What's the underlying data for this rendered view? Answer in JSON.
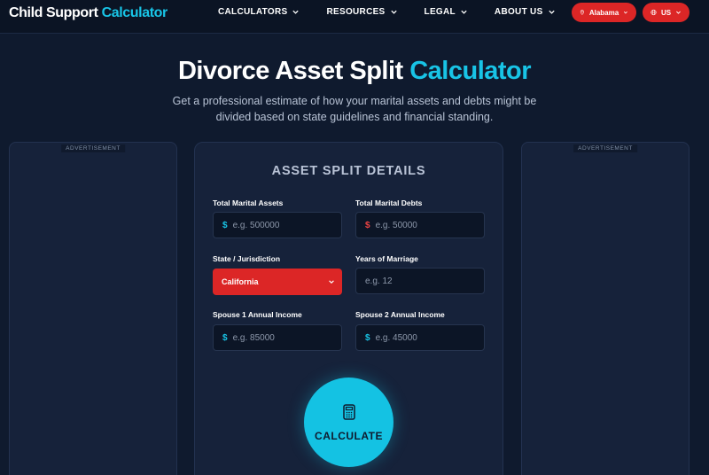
{
  "brand": {
    "name_main": "Child Support ",
    "name_accent": "Calculator"
  },
  "nav": {
    "items": [
      {
        "label": "CALCULATORS"
      },
      {
        "label": "RESOURCES"
      },
      {
        "label": "LEGAL"
      },
      {
        "label": "ABOUT US"
      }
    ],
    "state_selector": "Alabama",
    "country_selector": "US"
  },
  "hero": {
    "title_main": "Divorce Asset Split ",
    "title_accent": "Calculator",
    "subtitle": "Get a professional estimate of how your marital assets and debts might be divided based on state guidelines and financial standing."
  },
  "ads": {
    "label": "ADVERTISEMENT"
  },
  "form": {
    "title": "ASSET SPLIT DETAILS",
    "total_assets": {
      "label": "Total Marital Assets",
      "currency": "$",
      "placeholder": "e.g. 500000"
    },
    "total_debts": {
      "label": "Total Marital Debts",
      "currency": "$",
      "placeholder": "e.g. 50000"
    },
    "state": {
      "label": "State / Jurisdiction",
      "value": "California"
    },
    "years": {
      "label": "Years of Marriage",
      "placeholder": "e.g. 12"
    },
    "spouse1_income": {
      "label": "Spouse 1 Annual Income",
      "currency": "$",
      "placeholder": "e.g. 85000"
    },
    "spouse2_income": {
      "label": "Spouse 2 Annual Income",
      "currency": "$",
      "placeholder": "e.g. 45000"
    },
    "calculate_label": "CALCULATE"
  },
  "colors": {
    "accent": "#18c4e6",
    "danger": "#dc2626",
    "background": "#0f1a2e",
    "card": "#16223a"
  },
  "icons": [
    "chevron-down-icon",
    "map-pin-icon",
    "globe-icon",
    "calculator-icon"
  ]
}
